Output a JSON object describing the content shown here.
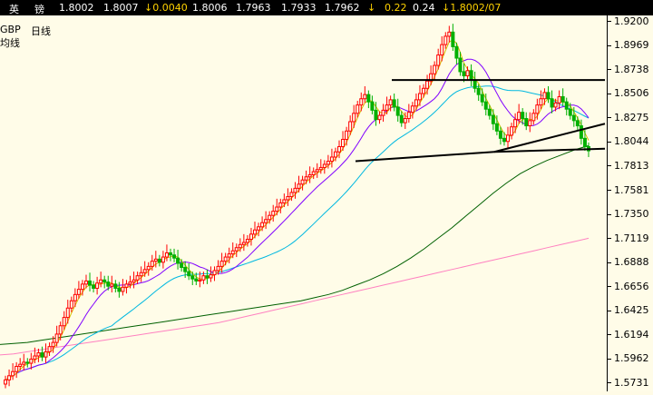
{
  "quote": {
    "name1": "英",
    "name2": "镑",
    "open": "1.8002",
    "high": "1.8007",
    "change": "↓0.0040",
    "bid": "1.8006",
    "ask": "1.7963",
    "v1": "1.7933",
    "v2": "1.7962",
    "arrow": "↓",
    "pct1": "0.22",
    "pct2": "0.24",
    "last": "↓1.8002/07"
  },
  "chart_header": {
    "symbol": "GBP",
    "period": "日线",
    "indicator": "均线"
  },
  "colors": {
    "up_candle": "#ff0000",
    "down_candle": "#00b000",
    "ma_fast": "#d8c000",
    "ma_mid": "#00b8e0",
    "ma_slow": "#8000ff",
    "ma_long": "#006000",
    "ma_vlong": "#ff80c0",
    "trendline": "#000000"
  },
  "chart_data": {
    "type": "candlestick",
    "y_ticks": [
      "1.9200",
      "1.8969",
      "1.8738",
      "1.8506",
      "1.8275",
      "1.8044",
      "1.7813",
      "1.7581",
      "1.7350",
      "1.7119",
      "1.6888",
      "1.6656",
      "1.6425",
      "1.6194",
      "1.5962",
      "1.5731"
    ],
    "ylim": [
      1.565,
      1.926
    ],
    "closes": [
      1.576,
      1.58,
      1.584,
      1.589,
      1.591,
      1.593,
      1.592,
      1.596,
      1.599,
      1.602,
      1.598,
      1.603,
      1.608,
      1.612,
      1.62,
      1.628,
      1.636,
      1.645,
      1.652,
      1.658,
      1.663,
      1.668,
      1.671,
      1.667,
      1.664,
      1.669,
      1.672,
      1.67,
      1.666,
      1.668,
      1.664,
      1.661,
      1.665,
      1.668,
      1.67,
      1.672,
      1.676,
      1.679,
      1.682,
      1.685,
      1.69,
      1.692,
      1.689,
      1.694,
      1.698,
      1.696,
      1.693,
      1.688,
      1.684,
      1.68,
      1.676,
      1.673,
      1.671,
      1.672,
      1.676,
      1.674,
      1.677,
      1.681,
      1.685,
      1.69,
      1.694,
      1.697,
      1.7,
      1.703,
      1.706,
      1.708,
      1.711,
      1.716,
      1.72,
      1.723,
      1.727,
      1.73,
      1.734,
      1.738,
      1.742,
      1.746,
      1.749,
      1.752,
      1.756,
      1.76,
      1.764,
      1.768,
      1.771,
      1.773,
      1.776,
      1.778,
      1.78,
      1.783,
      1.786,
      1.79,
      1.795,
      1.8,
      1.807,
      1.815,
      1.824,
      1.832,
      1.84,
      1.846,
      1.85,
      1.843,
      1.835,
      1.826,
      1.83,
      1.835,
      1.84,
      1.845,
      1.838,
      1.83,
      1.823,
      1.827,
      1.833,
      1.839,
      1.845,
      1.851,
      1.856,
      1.863,
      1.87,
      1.878,
      1.888,
      1.898,
      1.906,
      1.91,
      1.896,
      1.885,
      1.872,
      1.868,
      1.873,
      1.864,
      1.856,
      1.85,
      1.843,
      1.836,
      1.83,
      1.822,
      1.815,
      1.808,
      1.805,
      1.811,
      1.819,
      1.826,
      1.833,
      1.827,
      1.82,
      1.825,
      1.832,
      1.84,
      1.846,
      1.852,
      1.846,
      1.838,
      1.842,
      1.848,
      1.843,
      1.836,
      1.83,
      1.825,
      1.82,
      1.808,
      1.8,
      1.796
    ],
    "ma_long": [
      1.61,
      1.611,
      1.612,
      1.614,
      1.616,
      1.618,
      1.62,
      1.622,
      1.624,
      1.626,
      1.628,
      1.63,
      1.632,
      1.634,
      1.636,
      1.638,
      1.64,
      1.642,
      1.644,
      1.646,
      1.648,
      1.65,
      1.652,
      1.655,
      1.658,
      1.662,
      1.667,
      1.672,
      1.678,
      1.685,
      1.693,
      1.702,
      1.712,
      1.722,
      1.733,
      1.744,
      1.755,
      1.765,
      1.774,
      1.781,
      1.787,
      1.792,
      1.797,
      1.801
    ],
    "ma_vlong": [
      1.6,
      1.601,
      1.603,
      1.605,
      1.607,
      1.609,
      1.611,
      1.613,
      1.615,
      1.617,
      1.619,
      1.621,
      1.623,
      1.625,
      1.627,
      1.629,
      1.631,
      1.634,
      1.637,
      1.64,
      1.643,
      1.646,
      1.649,
      1.652,
      1.655,
      1.658,
      1.661,
      1.664,
      1.667,
      1.67,
      1.673,
      1.676,
      1.679,
      1.682,
      1.685,
      1.688,
      1.691,
      1.694,
      1.697,
      1.7,
      1.703,
      1.706,
      1.709,
      1.712
    ]
  }
}
